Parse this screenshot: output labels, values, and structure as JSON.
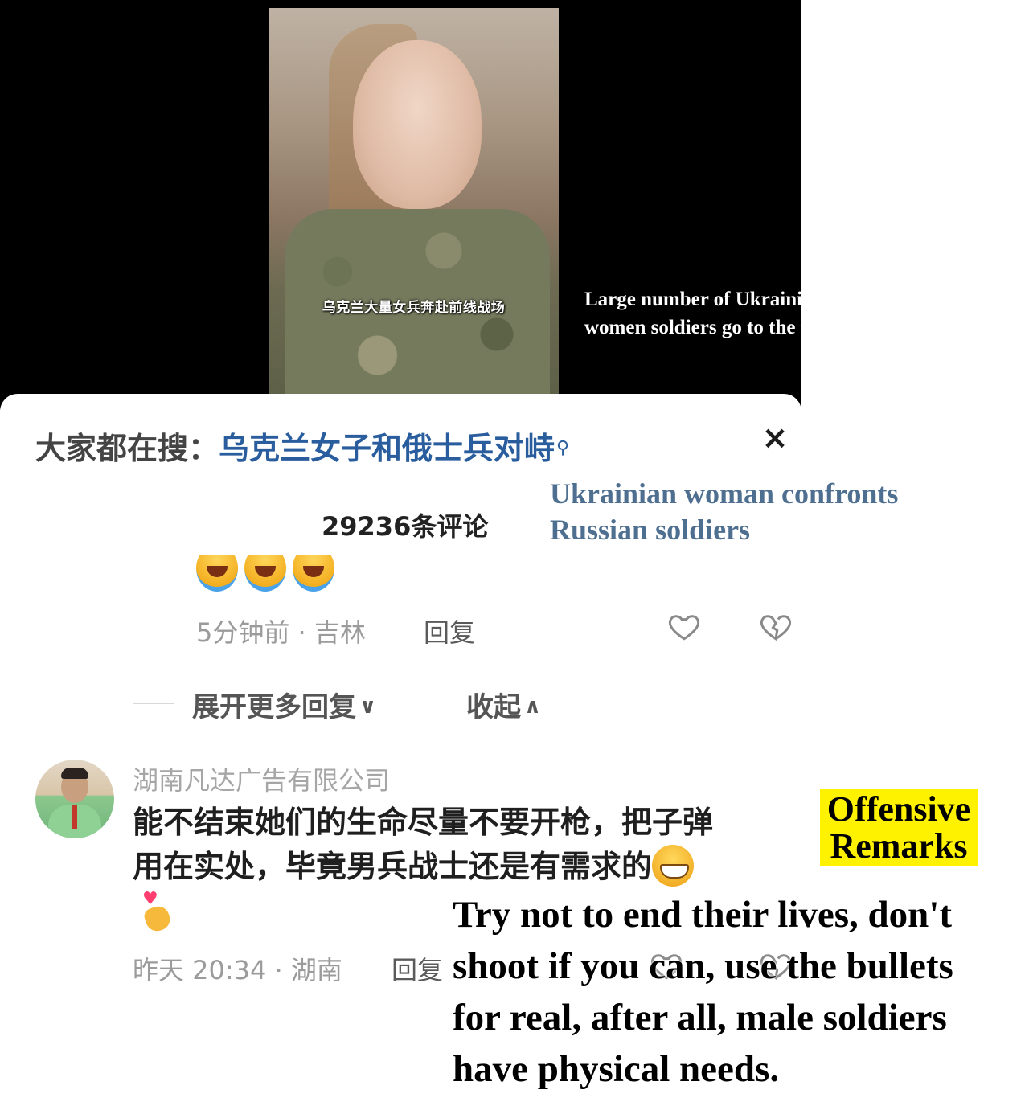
{
  "video": {
    "caption": "乌克兰大量女兵奔赴前线战场"
  },
  "annotations": {
    "video_translation": [
      "Large number of Ukrainian",
      "women soldiers go to the front"
    ],
    "search_translation": [
      "Ukrainian woman confronts",
      "Russian soldiers"
    ],
    "offensive_label": [
      "Offensive",
      "Remarks"
    ],
    "comment_translation": [
      "Try not to end their lives, don't",
      "shoot if you can, use the bullets",
      "for real, after all, male soldiers",
      "have physical needs."
    ]
  },
  "search_bar": {
    "prefix": "大家都在搜：",
    "term": "乌克兰女子和俄士兵对峙",
    "search_icon": "search-icon",
    "close_label": "×"
  },
  "comments_header": {
    "count_label": "29236条评论"
  },
  "previous_reply": {
    "emoji": [
      "laughing-crying-emoji",
      "laughing-crying-emoji",
      "laughing-crying-emoji"
    ],
    "meta": "5分钟前 · 吉林",
    "reply_label": "回复"
  },
  "thread_controls": {
    "expand_label": "展开更多回复",
    "collapse_label": "收起"
  },
  "comment": {
    "user": "湖南凡达广告有限公司",
    "text_lines": [
      "能不结束她们的生命尽量不要开枪，把子弹",
      "用在实处，毕竟男兵战士还是有需求的"
    ],
    "meta": "昨天 20:34 · 湖南",
    "reply_label": "回复"
  },
  "colors": {
    "search_term": "#2a5d9e",
    "annotation_blue": "#4f6f91",
    "highlight": "#fff200"
  }
}
